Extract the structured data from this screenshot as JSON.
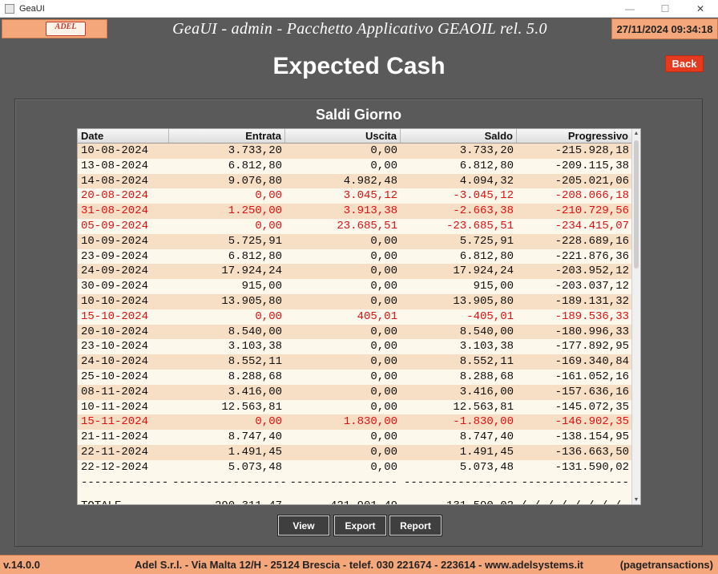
{
  "window": {
    "title": "GeaUI"
  },
  "header": {
    "logo_text": "ADEL",
    "app_title": "GeaUI - admin - Pacchetto Applicativo GEAOIL rel. 5.0",
    "datetime": "27/11/2024 09:34:18"
  },
  "page": {
    "title": "Expected Cash",
    "back_label": "Back"
  },
  "panel": {
    "title": "Saldi Giorno",
    "columns": [
      "Date",
      "Entrata",
      "Uscita",
      "Saldo",
      "Progressivo"
    ],
    "rows": [
      {
        "date": "10-08-2024",
        "entrata": "3.733,20",
        "uscita": "0,00",
        "saldo": "3.733,20",
        "progressivo": "-215.928,18",
        "negative": false
      },
      {
        "date": "13-08-2024",
        "entrata": "6.812,80",
        "uscita": "0,00",
        "saldo": "6.812,80",
        "progressivo": "-209.115,38",
        "negative": false
      },
      {
        "date": "14-08-2024",
        "entrata": "9.076,80",
        "uscita": "4.982,48",
        "saldo": "4.094,32",
        "progressivo": "-205.021,06",
        "negative": false
      },
      {
        "date": "20-08-2024",
        "entrata": "0,00",
        "uscita": "3.045,12",
        "saldo": "-3.045,12",
        "progressivo": "-208.066,18",
        "negative": true
      },
      {
        "date": "31-08-2024",
        "entrata": "1.250,00",
        "uscita": "3.913,38",
        "saldo": "-2.663,38",
        "progressivo": "-210.729,56",
        "negative": true
      },
      {
        "date": "05-09-2024",
        "entrata": "0,00",
        "uscita": "23.685,51",
        "saldo": "-23.685,51",
        "progressivo": "-234.415,07",
        "negative": true
      },
      {
        "date": "10-09-2024",
        "entrata": "5.725,91",
        "uscita": "0,00",
        "saldo": "5.725,91",
        "progressivo": "-228.689,16",
        "negative": false
      },
      {
        "date": "23-09-2024",
        "entrata": "6.812,80",
        "uscita": "0,00",
        "saldo": "6.812,80",
        "progressivo": "-221.876,36",
        "negative": false
      },
      {
        "date": "24-09-2024",
        "entrata": "17.924,24",
        "uscita": "0,00",
        "saldo": "17.924,24",
        "progressivo": "-203.952,12",
        "negative": false
      },
      {
        "date": "30-09-2024",
        "entrata": "915,00",
        "uscita": "0,00",
        "saldo": "915,00",
        "progressivo": "-203.037,12",
        "negative": false
      },
      {
        "date": "10-10-2024",
        "entrata": "13.905,80",
        "uscita": "0,00",
        "saldo": "13.905,80",
        "progressivo": "-189.131,32",
        "negative": false
      },
      {
        "date": "15-10-2024",
        "entrata": "0,00",
        "uscita": "405,01",
        "saldo": "-405,01",
        "progressivo": "-189.536,33",
        "negative": true
      },
      {
        "date": "20-10-2024",
        "entrata": "8.540,00",
        "uscita": "0,00",
        "saldo": "8.540,00",
        "progressivo": "-180.996,33",
        "negative": false
      },
      {
        "date": "23-10-2024",
        "entrata": "3.103,38",
        "uscita": "0,00",
        "saldo": "3.103,38",
        "progressivo": "-177.892,95",
        "negative": false
      },
      {
        "date": "24-10-2024",
        "entrata": "8.552,11",
        "uscita": "0,00",
        "saldo": "8.552,11",
        "progressivo": "-169.340,84",
        "negative": false
      },
      {
        "date": "25-10-2024",
        "entrata": "8.288,68",
        "uscita": "0,00",
        "saldo": "8.288,68",
        "progressivo": "-161.052,16",
        "negative": false
      },
      {
        "date": "08-11-2024",
        "entrata": "3.416,00",
        "uscita": "0,00",
        "saldo": "3.416,00",
        "progressivo": "-157.636,16",
        "negative": false
      },
      {
        "date": "10-11-2024",
        "entrata": "12.563,81",
        "uscita": "0,00",
        "saldo": "12.563,81",
        "progressivo": "-145.072,35",
        "negative": false
      },
      {
        "date": "15-11-2024",
        "entrata": "0,00",
        "uscita": "1.830,00",
        "saldo": "-1.830,00",
        "progressivo": "-146.902,35",
        "negative": true
      },
      {
        "date": "21-11-2024",
        "entrata": "8.747,40",
        "uscita": "0,00",
        "saldo": "8.747,40",
        "progressivo": "-138.154,95",
        "negative": false
      },
      {
        "date": "22-11-2024",
        "entrata": "1.491,45",
        "uscita": "0,00",
        "saldo": "1.491,45",
        "progressivo": "-136.663,50",
        "negative": false
      },
      {
        "date": "22-12-2024",
        "entrata": "5.073,48",
        "uscita": "0,00",
        "saldo": "5.073,48",
        "progressivo": "-131.590,02",
        "negative": false
      }
    ],
    "separator": [
      "-------------",
      "-----------------",
      "----------------",
      "-----------------",
      "----------------"
    ],
    "total": {
      "label": "TOTALE",
      "entrata": "290.311,47",
      "uscita": "421.901,49",
      "saldo": "-131.590,02",
      "progressivo": "/ / / / / / / /"
    }
  },
  "buttons": {
    "view": "View",
    "export": "Export",
    "report": "Report"
  },
  "footer": {
    "version": "v.14.0.0",
    "company": "Adel S.r.l. - Via Malta 12/H - 25124 Brescia - telef. 030 221674 - 223614 - www.adelsystems.it",
    "page": "(pagetransactions)"
  },
  "colors": {
    "accent": "#f4a77a",
    "negative": "#e01010",
    "back_button": "#e63a1e",
    "background": "#5a5a5a"
  }
}
